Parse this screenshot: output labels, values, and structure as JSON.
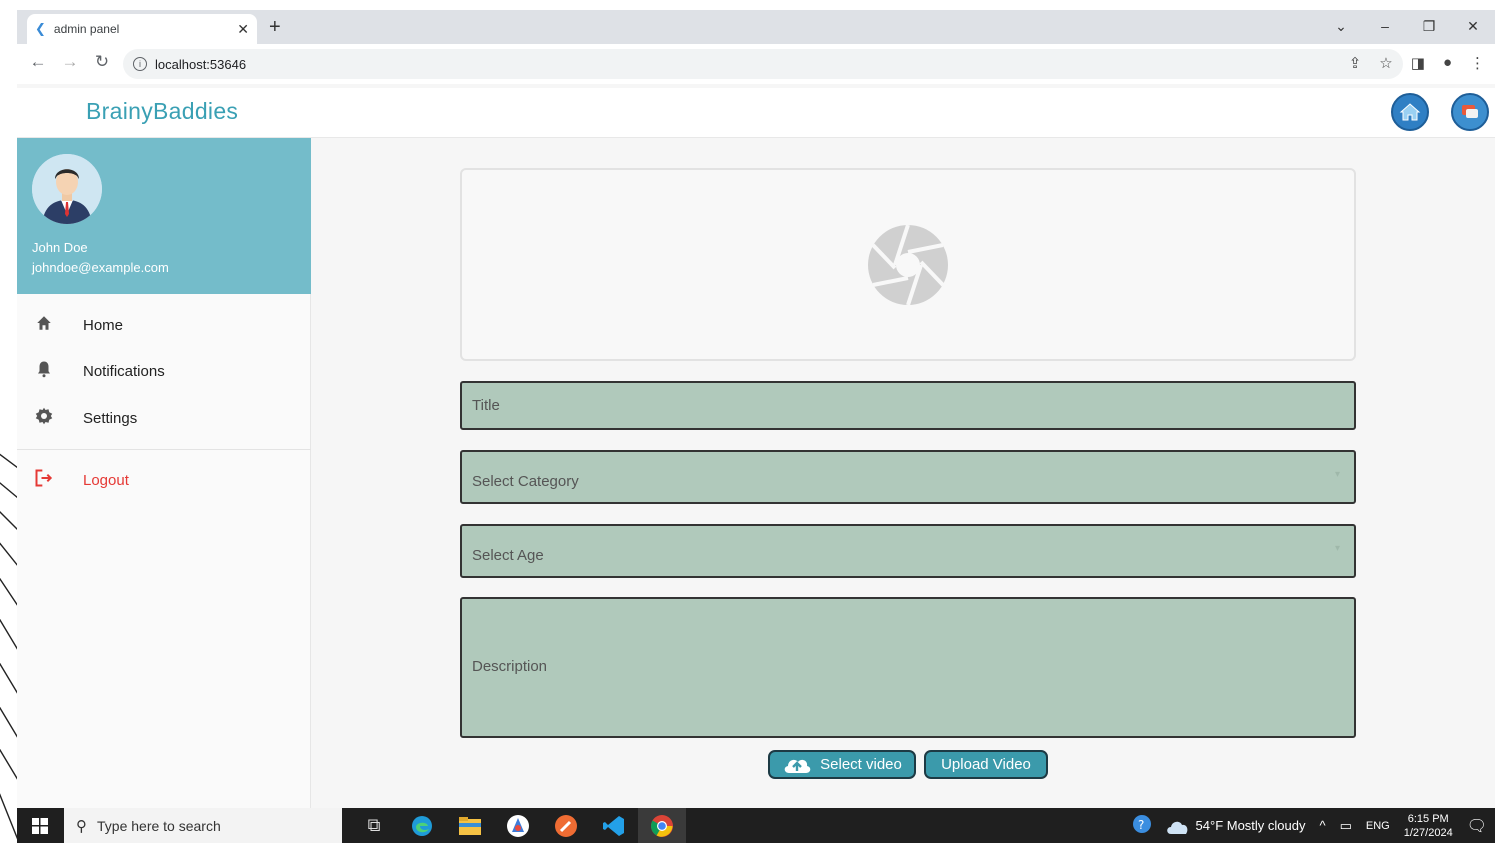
{
  "browser": {
    "tab_title": "admin panel",
    "url": "localhost:53646"
  },
  "app": {
    "brand": "BrainyBaddies"
  },
  "user": {
    "name": "John Doe",
    "email": "johndoe@example.com"
  },
  "sidebar": {
    "items": [
      {
        "label": "Home",
        "icon": "home-icon"
      },
      {
        "label": "Notifications",
        "icon": "bell-icon"
      },
      {
        "label": "Settings",
        "icon": "gear-icon"
      }
    ],
    "logout": "Logout"
  },
  "form": {
    "title_placeholder": "Title",
    "category_placeholder": "Select Category",
    "age_placeholder": "Select Age",
    "description_placeholder": "Description",
    "select_video_label": "Select video",
    "upload_video_label": "Upload Video"
  },
  "taskbar": {
    "search_placeholder": "Type here to search",
    "weather": "54°F  Mostly cloudy",
    "language": "ENG",
    "time": "6:15 PM",
    "date": "1/27/2024"
  },
  "colors": {
    "brand": "#3aa0b4",
    "sidebar_header": "#74bcca",
    "field_bg": "#b0c9bb",
    "button_bg": "#3b9aab",
    "logout": "#e53935"
  }
}
